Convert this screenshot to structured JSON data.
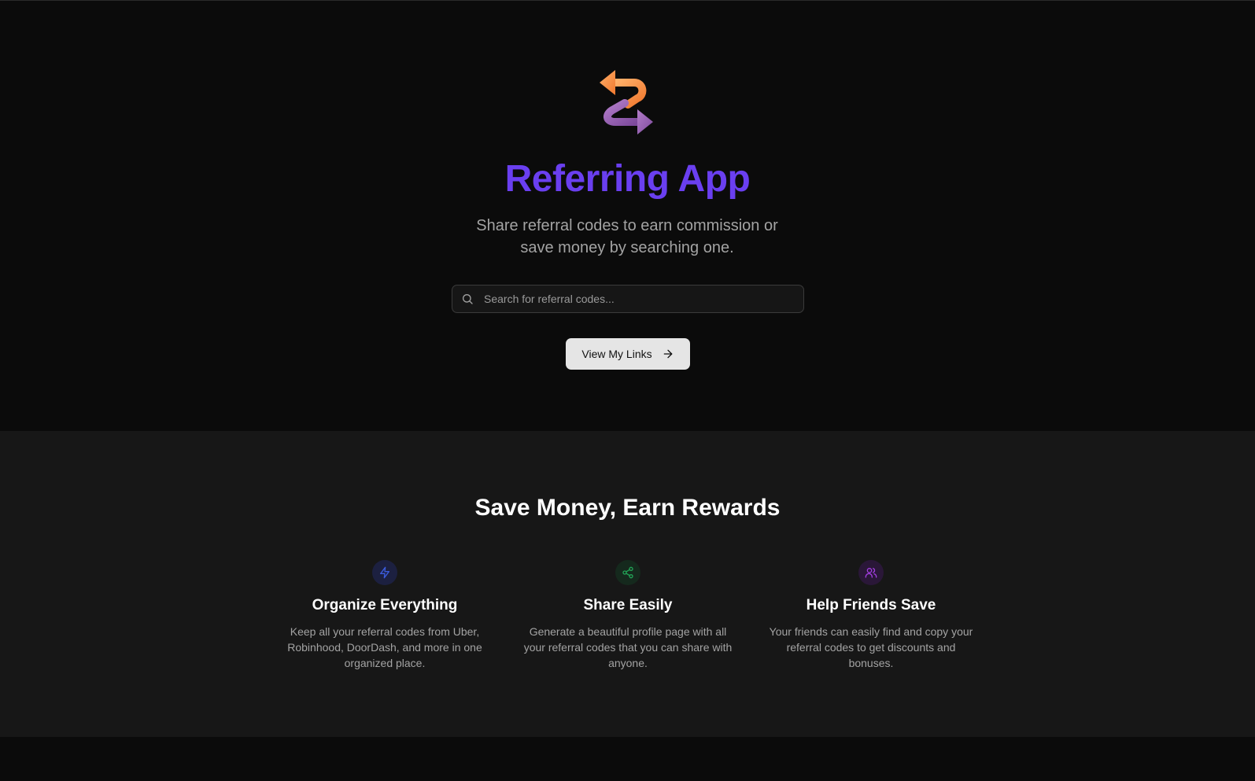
{
  "hero": {
    "logo_icon": "referral-arrows-logo-icon",
    "title": "Referring App",
    "tagline": "Share referral codes to earn commission or save money by searching one.",
    "search": {
      "placeholder": "Search for referral codes...",
      "value": "",
      "icon": "search-icon"
    },
    "cta": {
      "label": "View My Links",
      "icon": "arrow-right-icon"
    },
    "colors": {
      "title": "#6a3ff0",
      "logo_orange": "#f58a3c",
      "logo_purple": "#9b5fb5"
    }
  },
  "features": {
    "title": "Save Money, Earn Rewards",
    "items": [
      {
        "icon": "lightning-icon",
        "color": "#3b5bdb",
        "title": "Organize Everything",
        "description": "Keep all your referral codes from Uber, Robinhood, DoorDash, and more in one organized place."
      },
      {
        "icon": "share-icon",
        "color": "#22a356",
        "title": "Share Easily",
        "description": "Generate a beautiful profile page with all your referral codes that you can share with anyone."
      },
      {
        "icon": "users-icon",
        "color": "#a23ee0",
        "title": "Help Friends Save",
        "description": "Your friends can easily find and copy your referral codes to get discounts and bonuses."
      }
    ]
  }
}
